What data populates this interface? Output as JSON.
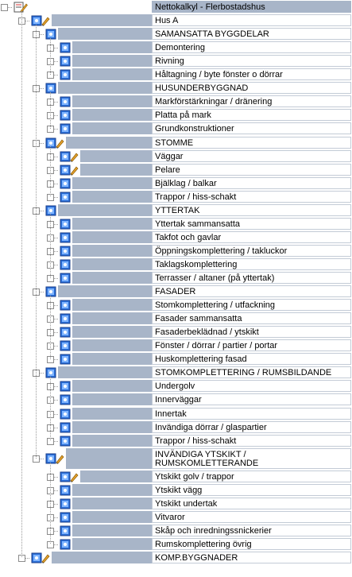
{
  "tree": [
    {
      "level": 0,
      "label": "Nettokalkyl - Flerbostadshus",
      "icon": "edit-doc",
      "toggle": "-",
      "highlight": true
    },
    {
      "level": 1,
      "label": "Hus A",
      "icon": "pencil-node",
      "toggle": "-"
    },
    {
      "level": 2,
      "label": "SAMANSATTA BYGGDELAR",
      "icon": "node",
      "toggle": "-"
    },
    {
      "level": 3,
      "label": "Demontering",
      "icon": "node",
      "toggle": "+"
    },
    {
      "level": 3,
      "label": "Rivning",
      "icon": "node",
      "toggle": "+"
    },
    {
      "level": 3,
      "label": "Håltagning / byte fönster o dörrar",
      "icon": "node",
      "toggle": "+"
    },
    {
      "level": 2,
      "label": "HUSUNDERBYGGNAD",
      "icon": "node",
      "toggle": "-"
    },
    {
      "level": 3,
      "label": "Markförstärkningar / dränering",
      "icon": "node",
      "toggle": "+"
    },
    {
      "level": 3,
      "label": "Platta på mark",
      "icon": "node",
      "toggle": "+"
    },
    {
      "level": 3,
      "label": "Grundkonstruktioner",
      "icon": "node",
      "toggle": "+"
    },
    {
      "level": 2,
      "label": "STOMME",
      "icon": "pencil-node",
      "toggle": "-"
    },
    {
      "level": 3,
      "label": "Väggar",
      "icon": "pencil-node",
      "toggle": "+"
    },
    {
      "level": 3,
      "label": "Pelare",
      "icon": "pencil-node",
      "toggle": "+"
    },
    {
      "level": 3,
      "label": "Bjälklag / balkar",
      "icon": "node",
      "toggle": "+"
    },
    {
      "level": 3,
      "label": "Trappor / hiss-schakt",
      "icon": "node",
      "toggle": "+"
    },
    {
      "level": 2,
      "label": "YTTERTAK",
      "icon": "node",
      "toggle": "-"
    },
    {
      "level": 3,
      "label": "Yttertak sammansatta",
      "icon": "node",
      "toggle": "+"
    },
    {
      "level": 3,
      "label": "Takfot och gavlar",
      "icon": "node",
      "toggle": "+"
    },
    {
      "level": 3,
      "label": "Öppningskomplettering / takluckor",
      "icon": "node",
      "toggle": "+"
    },
    {
      "level": 3,
      "label": "Taklagskomplettering",
      "icon": "node",
      "toggle": "+"
    },
    {
      "level": 3,
      "label": "Terrasser / altaner (på yttertak)",
      "icon": "node",
      "toggle": "+"
    },
    {
      "level": 2,
      "label": "FASADER",
      "icon": "node",
      "toggle": "-"
    },
    {
      "level": 3,
      "label": "Stomkomplettering / utfackning",
      "icon": "node",
      "toggle": "+"
    },
    {
      "level": 3,
      "label": "Fasader sammansatta",
      "icon": "node",
      "toggle": "+"
    },
    {
      "level": 3,
      "label": "Fasaderbeklädnad / ytskikt",
      "icon": "node",
      "toggle": "+"
    },
    {
      "level": 3,
      "label": "Fönster / dörrar / partier / portar",
      "icon": "node",
      "toggle": "+"
    },
    {
      "level": 3,
      "label": "Huskomplettering fasad",
      "icon": "node",
      "toggle": "+"
    },
    {
      "level": 2,
      "label": "STOMKOMPLETTERING / RUMSBILDANDE",
      "icon": "node",
      "toggle": "-"
    },
    {
      "level": 3,
      "label": "Undergolv",
      "icon": "node",
      "toggle": "+"
    },
    {
      "level": 3,
      "label": "Innerväggar",
      "icon": "node",
      "toggle": "+"
    },
    {
      "level": 3,
      "label": "Innertak",
      "icon": "node",
      "toggle": "+"
    },
    {
      "level": 3,
      "label": "Invändiga dörrar / glaspartier",
      "icon": "node",
      "toggle": "+"
    },
    {
      "level": 3,
      "label": "Trappor / hiss-schakt",
      "icon": "node",
      "toggle": "+"
    },
    {
      "level": 2,
      "label": "INVÄNDIGA YTSKIKT / RUMSKOMLETTERANDE",
      "icon": "pencil-node",
      "toggle": "-",
      "tall": true
    },
    {
      "level": 3,
      "label": "Ytskikt golv / trappor",
      "icon": "pencil-node",
      "toggle": "+"
    },
    {
      "level": 3,
      "label": "Ytskikt vägg",
      "icon": "node",
      "toggle": "+"
    },
    {
      "level": 3,
      "label": "Ytskikt undertak",
      "icon": "node",
      "toggle": "+"
    },
    {
      "level": 3,
      "label": "Vitvaror",
      "icon": "node",
      "toggle": "+"
    },
    {
      "level": 3,
      "label": "Skåp och inredningssnickerier",
      "icon": "node",
      "toggle": "+"
    },
    {
      "level": 3,
      "label": "Rumskomplettering övrig",
      "icon": "node",
      "toggle": "+"
    },
    {
      "level": 1,
      "label": "KOMP.BYGGNADER",
      "icon": "pencil-node",
      "toggle": "+"
    }
  ]
}
